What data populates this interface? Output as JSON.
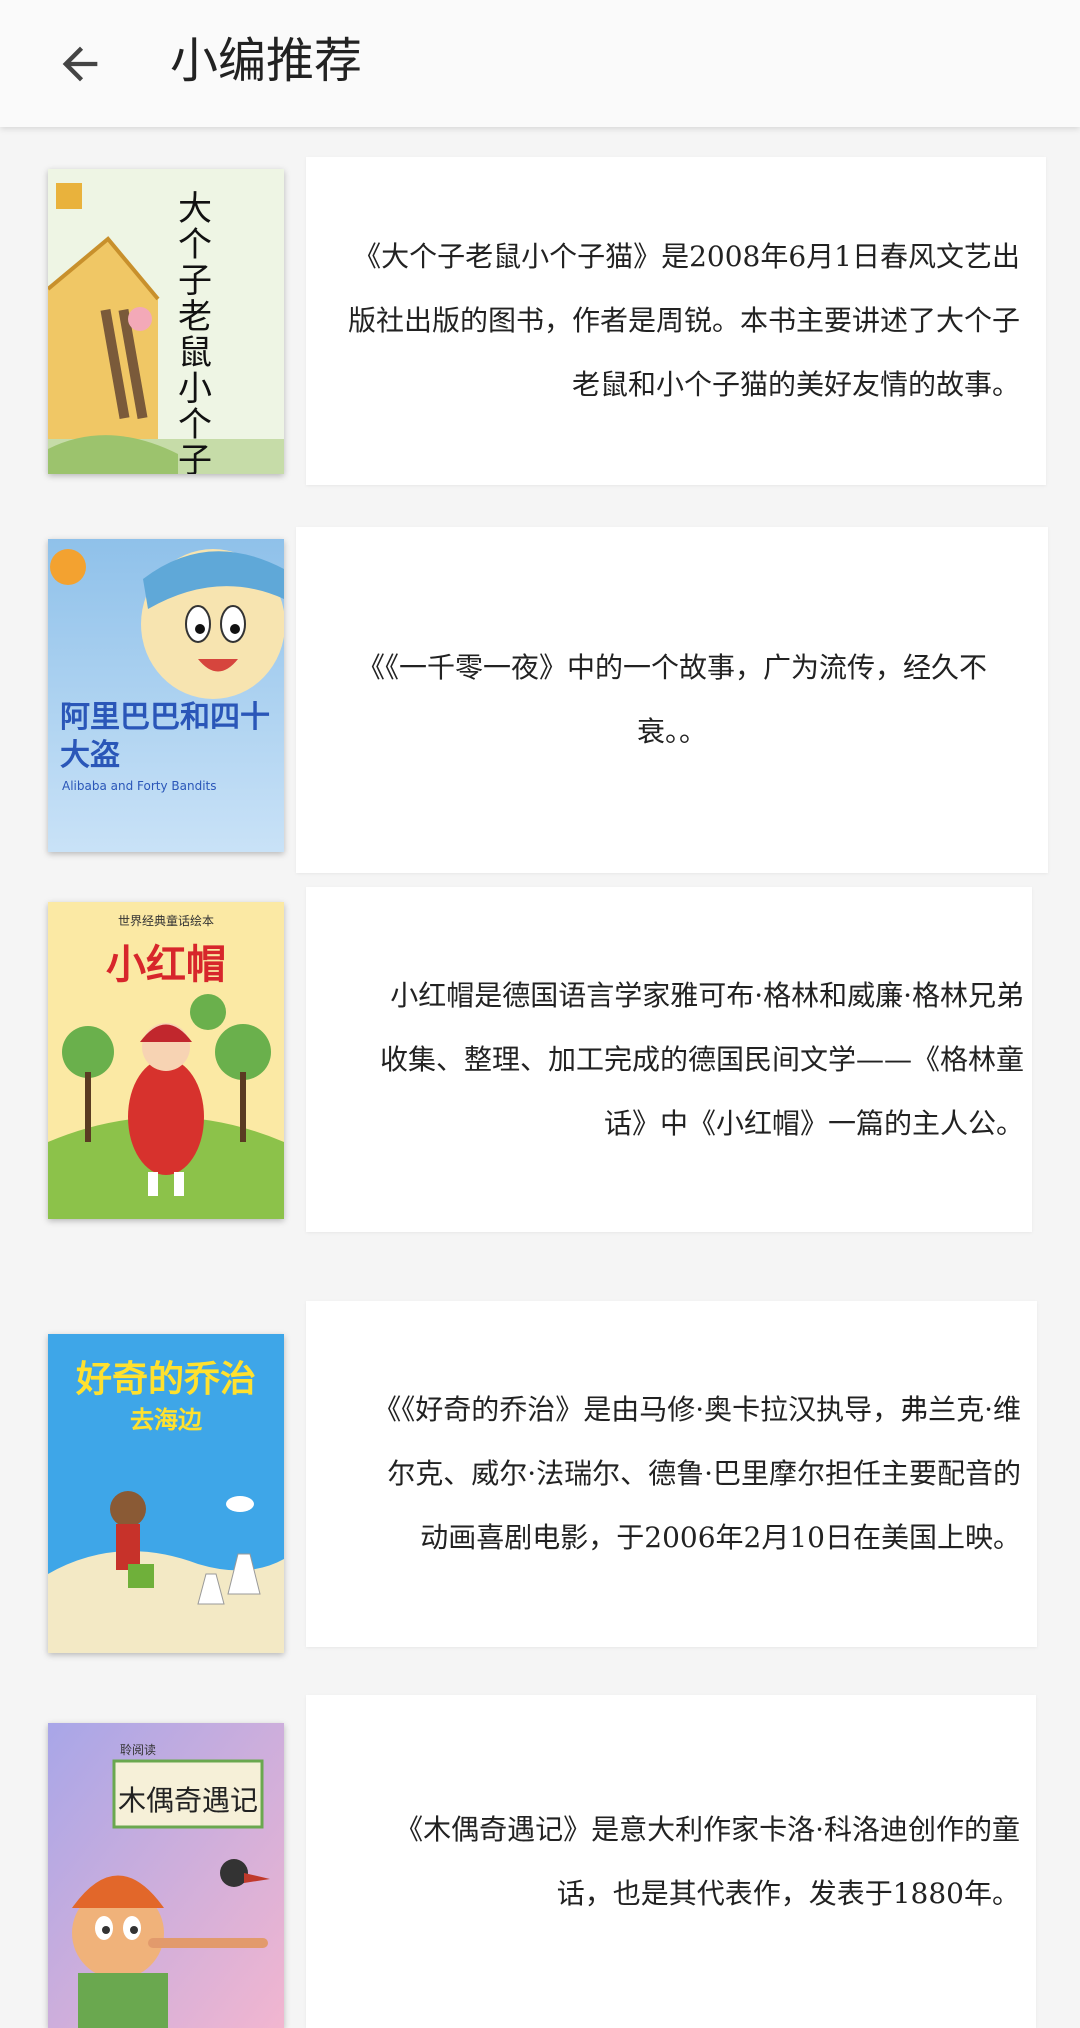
{
  "app_bar": {
    "title": "小编推荐",
    "back_icon": "arrow-left-icon"
  },
  "colors": {
    "background": "#f5f5f5",
    "card": "#ffffff",
    "text": "#222222"
  },
  "books": [
    {
      "cover_title": "大个子老鼠小个子猫",
      "description": "《大个子老鼠小个子猫》是2008年6月1日春风文艺出版社出版的图书，作者是周锐。本书主要讲述了大个子老鼠和小个子猫的美好友情的故事。"
    },
    {
      "cover_title": "阿里巴巴和四十大盗",
      "cover_subtitle": "Alibaba and Forty Bandits",
      "description": "《《一千零一夜》中的一个故事，广为流传，经久不衰。。"
    },
    {
      "cover_title": "小红帽",
      "cover_series": "世界经典童话绘本",
      "description": "小红帽是德国语言学家雅可布·格林和威廉·格林兄弟收集、整理、加工完成的德国民间文学——《格林童话》中《小红帽》一篇的主人公。"
    },
    {
      "cover_title": "好奇的乔治",
      "cover_subtitle": "去海边",
      "description": "《《好奇的乔治》是由马修·奥卡拉汉执导，弗兰克·维尔克、威尔·法瑞尔、德鲁·巴里摩尔担任主要配音的动画喜剧电影，于2006年2月10日在美国上映。"
    },
    {
      "cover_title": "木偶奇遇记",
      "cover_series": "聆阅读",
      "description": "《木偶奇遇记》是意大利作家卡洛·科洛迪创作的童话，也是其代表作，发表于1880年。"
    }
  ]
}
